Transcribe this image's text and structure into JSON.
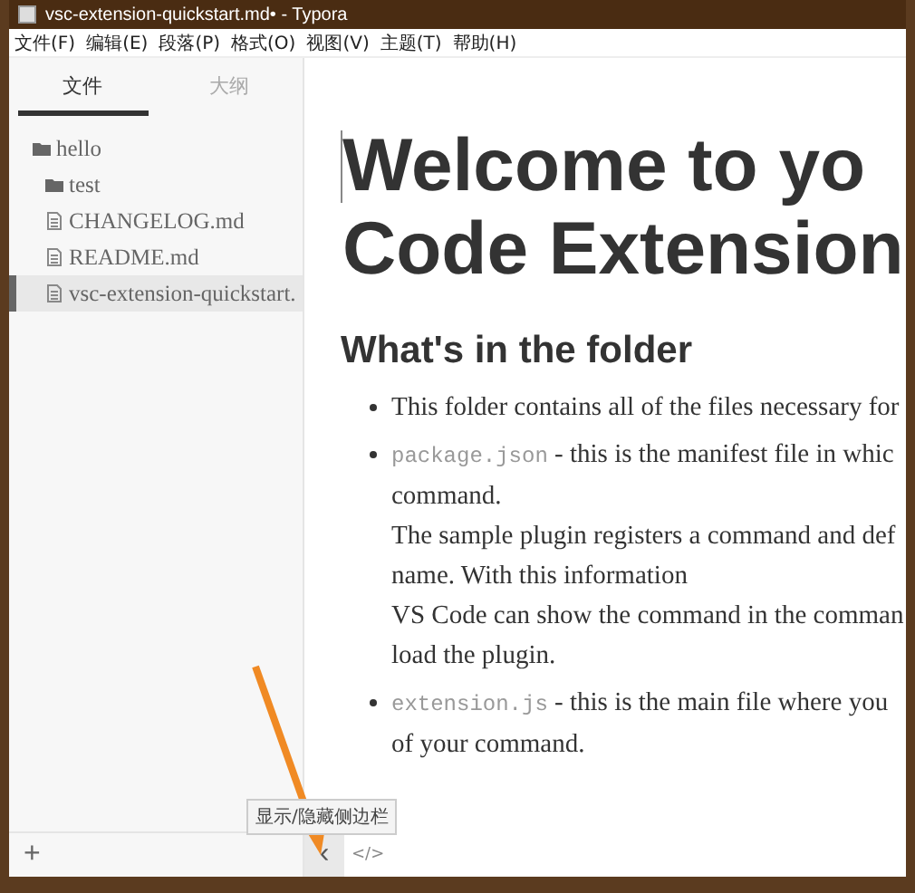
{
  "window": {
    "title": "vsc-extension-quickstart.md• - Typora"
  },
  "menu": [
    "文件(F)",
    "编辑(E)",
    "段落(P)",
    "格式(O)",
    "视图(V)",
    "主题(T)",
    "帮助(H)"
  ],
  "sidebar": {
    "tabs": [
      {
        "label": "文件",
        "selected": true
      },
      {
        "label": "大纲",
        "selected": false
      }
    ],
    "tree": [
      {
        "kind": "folder",
        "name": "hello",
        "selected": false,
        "children": [
          {
            "kind": "folder",
            "name": "test",
            "selected": false
          },
          {
            "kind": "file",
            "name": "CHANGELOG.md",
            "selected": false
          },
          {
            "kind": "file",
            "name": "README.md",
            "selected": false
          },
          {
            "kind": "file",
            "name": "vsc-extension-quickstart.",
            "selected": true
          }
        ]
      }
    ]
  },
  "document": {
    "title_lines": [
      "Welcome to yo",
      "Code Extension"
    ],
    "heading": "What's in the folder",
    "bullets": [
      {
        "lines": [
          {
            "text": "This folder contains all of the files necessary for"
          }
        ]
      },
      {
        "lines": [
          {
            "code": "package.json",
            "text": " - this is the manifest file in whic"
          },
          {
            "text": "command."
          },
          {
            "text": "The sample plugin registers a command and def"
          },
          {
            "text": "name. With this information"
          },
          {
            "text": "VS Code can show the command in the comman"
          },
          {
            "text": "load the plugin."
          }
        ]
      },
      {
        "lines": [
          {
            "code": "extension.js",
            "text": " - this is the main file where you"
          },
          {
            "text": "of your command."
          }
        ]
      }
    ]
  },
  "bottom_bar": {
    "add": "+",
    "toggle": "‹",
    "source": "</>"
  },
  "tooltip": "显示/隐藏侧边栏"
}
